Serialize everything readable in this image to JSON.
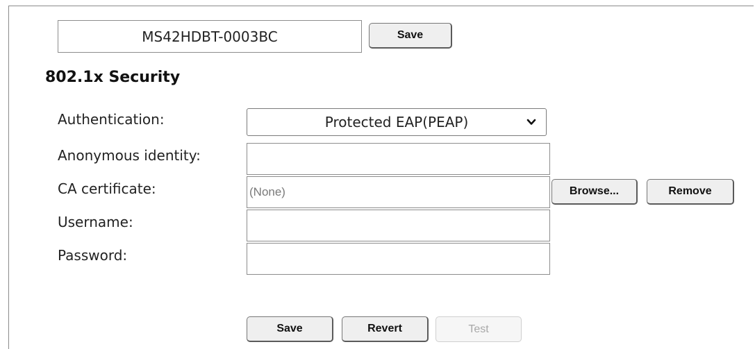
{
  "device": {
    "hostname": "MS42HDBT-0003BC",
    "save_label": "Save"
  },
  "security": {
    "title": "802.1x Security",
    "authentication": {
      "label": "Authentication:",
      "selected": "Protected EAP(PEAP)"
    },
    "anonymous_identity": {
      "label": "Anonymous identity:",
      "value": ""
    },
    "ca_certificate": {
      "label": "CA certificate:",
      "value": "(None)",
      "browse_label": "Browse...",
      "remove_label": "Remove"
    },
    "username": {
      "label": "Username:",
      "value": ""
    },
    "password": {
      "label": "Password:",
      "value": ""
    }
  },
  "actions": {
    "save_label": "Save",
    "revert_label": "Revert",
    "test_label": "Test"
  },
  "icons": {
    "select_arrow": "chevron-down-icon"
  }
}
